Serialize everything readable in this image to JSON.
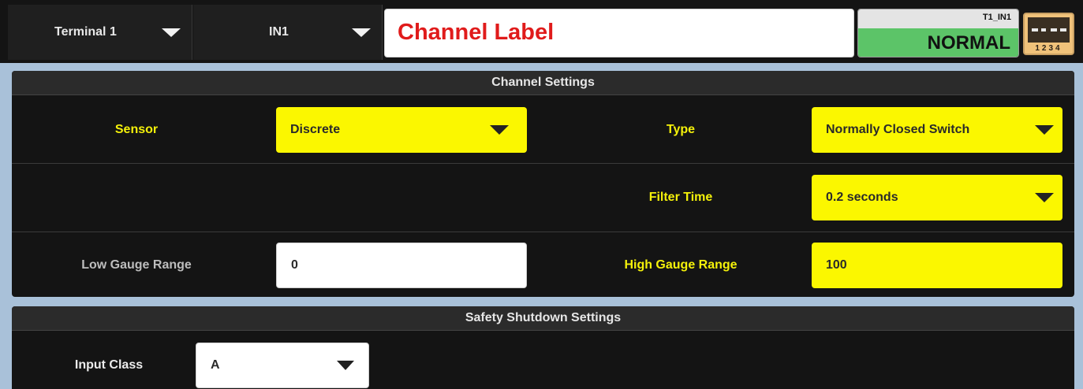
{
  "topbar": {
    "terminal_select": "Terminal 1",
    "input_select": "IN1",
    "channel_label": "Channel Label",
    "status_channel_id": "T1_IN1",
    "status_text": "NORMAL",
    "terminal_icon_numbers": "1234",
    "status_color": "#5cc468"
  },
  "channel_settings": {
    "title": "Channel Settings",
    "sensor_label": "Sensor",
    "sensor_value": "Discrete",
    "type_label": "Type",
    "type_value": "Normally Closed Switch",
    "filter_time_label": "Filter Time",
    "filter_time_value": "0.2 seconds",
    "low_gauge_label": "Low Gauge Range",
    "low_gauge_value": "0",
    "high_gauge_label": "High Gauge Range",
    "high_gauge_value": "100"
  },
  "safety_shutdown": {
    "title": "Safety Shutdown Settings",
    "input_class_label": "Input Class",
    "input_class_value": "A"
  },
  "colors": {
    "accent_yellow": "#fbf700",
    "label_yellow": "#f4f10a",
    "label_red": "#e01b1b",
    "background": "#141414"
  }
}
